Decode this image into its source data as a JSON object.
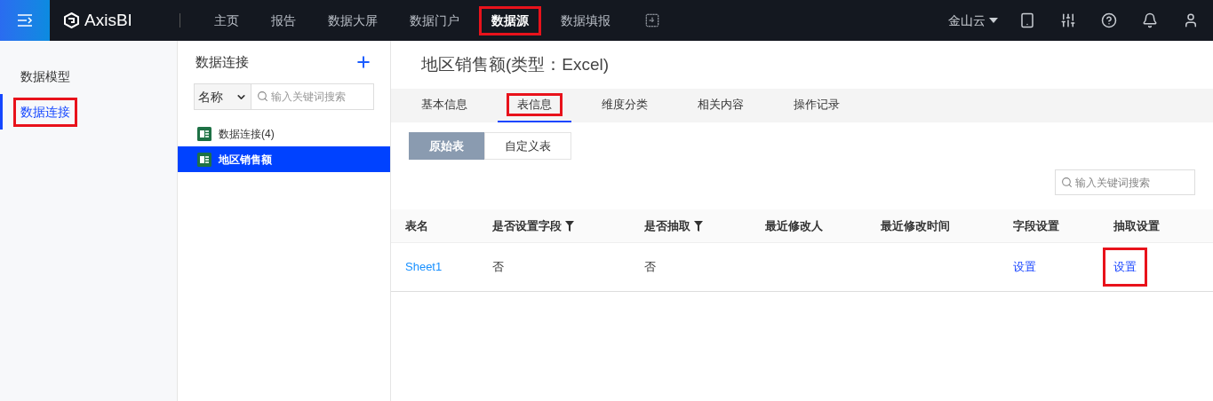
{
  "top_nav": {
    "brand": "AxisBI",
    "items": [
      {
        "label": "主页",
        "selected": false,
        "highlighted": false
      },
      {
        "label": "报告",
        "selected": false,
        "highlighted": false
      },
      {
        "label": "数据大屏",
        "selected": false,
        "highlighted": false
      },
      {
        "label": "数据门户",
        "selected": false,
        "highlighted": false
      },
      {
        "label": "数据源",
        "selected": true,
        "highlighted": true
      },
      {
        "label": "数据填报",
        "selected": false,
        "highlighted": false
      }
    ],
    "account": "金山云"
  },
  "sidebar": {
    "items": [
      {
        "label": "数据模型",
        "selected": false,
        "highlighted": false
      },
      {
        "label": "数据连接",
        "selected": true,
        "highlighted": true
      }
    ]
  },
  "connections": {
    "title": "数据连接",
    "filter": {
      "value": "名称"
    },
    "search": {
      "placeholder": "输入关键词搜索"
    },
    "items": [
      {
        "label": "数据连接(4)",
        "selected": false
      },
      {
        "label": "地区销售额",
        "selected": true
      }
    ]
  },
  "detail": {
    "title": "地区销售额(类型：Excel)",
    "tabs": [
      {
        "label": "基本信息",
        "selected": false,
        "highlighted": false
      },
      {
        "label": "表信息",
        "selected": true,
        "highlighted": true
      },
      {
        "label": "维度分类",
        "selected": false,
        "highlighted": false
      },
      {
        "label": "相关内容",
        "selected": false,
        "highlighted": false
      },
      {
        "label": "操作记录",
        "selected": false,
        "highlighted": false
      }
    ],
    "views": [
      {
        "label": "原始表",
        "selected": true
      },
      {
        "label": "自定义表",
        "selected": false
      }
    ],
    "search": {
      "placeholder": "输入关键词搜索"
    },
    "table": {
      "columns": [
        {
          "label": "表名",
          "filter": false
        },
        {
          "label": "是否设置字段",
          "filter": true
        },
        {
          "label": "是否抽取",
          "filter": true
        },
        {
          "label": "最近修改人",
          "filter": false
        },
        {
          "label": "最近修改时间",
          "filter": false
        },
        {
          "label": "字段设置",
          "filter": false
        },
        {
          "label": "抽取设置",
          "filter": false
        }
      ],
      "rows": [
        {
          "cells": [
            {
              "text": "Sheet1",
              "kind": "link",
              "highlighted": false
            },
            {
              "text": "否",
              "kind": "text",
              "highlighted": false
            },
            {
              "text": "否",
              "kind": "text",
              "highlighted": false
            },
            {
              "kind": "empty"
            },
            {
              "kind": "empty"
            },
            {
              "text": "设置",
              "kind": "link",
              "highlighted": false
            },
            {
              "text": "设置",
              "kind": "link",
              "highlighted": true
            }
          ]
        }
      ]
    }
  }
}
